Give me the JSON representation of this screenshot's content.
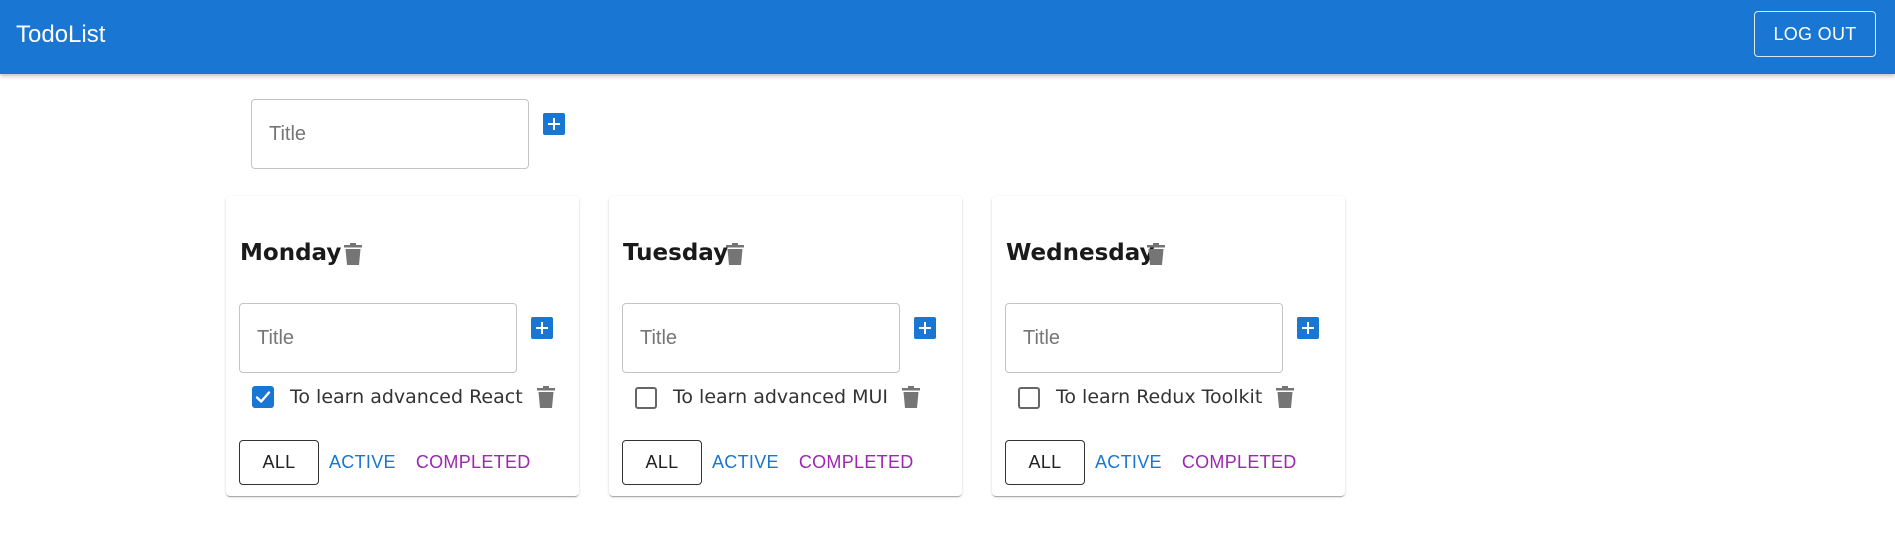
{
  "app": {
    "title": "TodoList",
    "logout_label": "LOG OUT",
    "accent_color": "#1976d2"
  },
  "add_list": {
    "placeholder": "Title",
    "value": ""
  },
  "lists": [
    {
      "title": "Monday",
      "input_placeholder": "Title",
      "tasks": [
        {
          "label": "To learn advanced React",
          "done": true
        }
      ],
      "filters": {
        "all": "ALL",
        "active": "ACTIVE",
        "completed": "COMPLETED"
      },
      "selected_filter": "ALL"
    },
    {
      "title": "Tuesday",
      "input_placeholder": "Title",
      "tasks": [
        {
          "label": "To learn advanced MUI",
          "done": false
        }
      ],
      "filters": {
        "all": "ALL",
        "active": "ACTIVE",
        "completed": "COMPLETED"
      },
      "selected_filter": "ALL"
    },
    {
      "title": "Wednesday",
      "input_placeholder": "Title",
      "tasks": [
        {
          "label": "To learn Redux Toolkit",
          "done": false
        }
      ],
      "filters": {
        "all": "ALL",
        "active": "ACTIVE",
        "completed": "COMPLETED"
      },
      "selected_filter": "ALL"
    }
  ],
  "icons": {
    "add": "plus-box-icon",
    "delete": "trash-icon",
    "checkbox": "checkbox-icon"
  }
}
